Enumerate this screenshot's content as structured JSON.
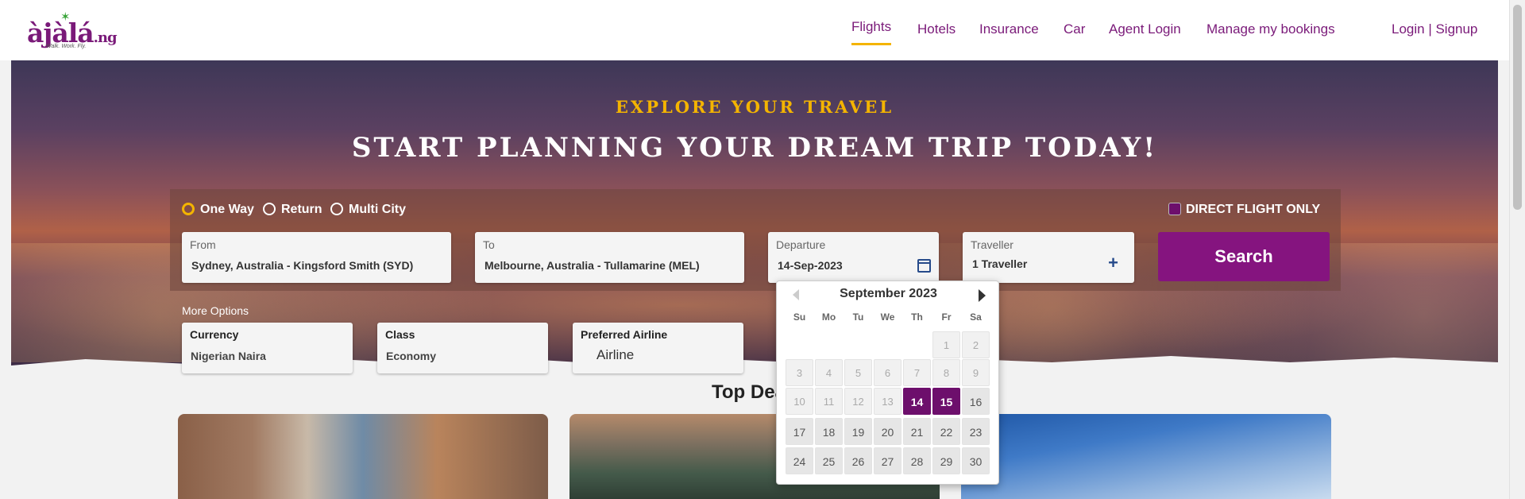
{
  "logo": {
    "main": "àjàlá",
    "tld": ".ng",
    "tagline": "Walk. Work. Fly."
  },
  "nav": {
    "flights": "Flights",
    "hotels": "Hotels",
    "insurance": "Insurance",
    "car": "Car",
    "agent_login": "Agent Login",
    "manage_bookings": "Manage my bookings",
    "login_signup": "Login | Signup"
  },
  "hero": {
    "eyebrow": "EXPLORE YOUR TRAVEL",
    "headline": "START PLANNING YOUR DREAM TRIP TODAY!"
  },
  "trip_types": {
    "one_way": "One Way",
    "return": "Return",
    "multi_city": "Multi City",
    "selected": "One Way"
  },
  "direct_flight": {
    "label": "DIRECT FLIGHT ONLY",
    "checked": true
  },
  "fields": {
    "from": {
      "label": "From",
      "value": "Sydney, Australia - Kingsford Smith (SYD)"
    },
    "to": {
      "label": "To",
      "value": "Melbourne, Australia - Tullamarine (MEL)"
    },
    "departure": {
      "label": "Departure",
      "value": "14-Sep-2023"
    },
    "traveller": {
      "label": "Traveller",
      "value": "1 Traveller"
    }
  },
  "search_button": "Search",
  "more_options": {
    "title": "More Options",
    "currency": {
      "label": "Currency",
      "value": "Nigerian Naira"
    },
    "class": {
      "label": "Class",
      "value": "Economy"
    },
    "airline": {
      "label": "Preferred Airline",
      "placeholder": "Airline"
    }
  },
  "top_deals": "Top Deals",
  "calendar": {
    "month_title": "September 2023",
    "weekdays": [
      "Su",
      "Mo",
      "Tu",
      "We",
      "Th",
      "Fr",
      "Sa"
    ],
    "selected": [
      14,
      15
    ],
    "first_available": 16,
    "days": [
      1,
      2,
      3,
      4,
      5,
      6,
      7,
      8,
      9,
      10,
      11,
      12,
      13,
      14,
      15,
      16,
      17,
      18,
      19,
      20,
      21,
      22,
      23,
      24,
      25,
      26,
      27,
      28,
      29,
      30
    ]
  },
  "colors": {
    "brand_purple": "#85147f",
    "accent_gold": "#f4b400",
    "icon_blue": "#264a8a"
  }
}
